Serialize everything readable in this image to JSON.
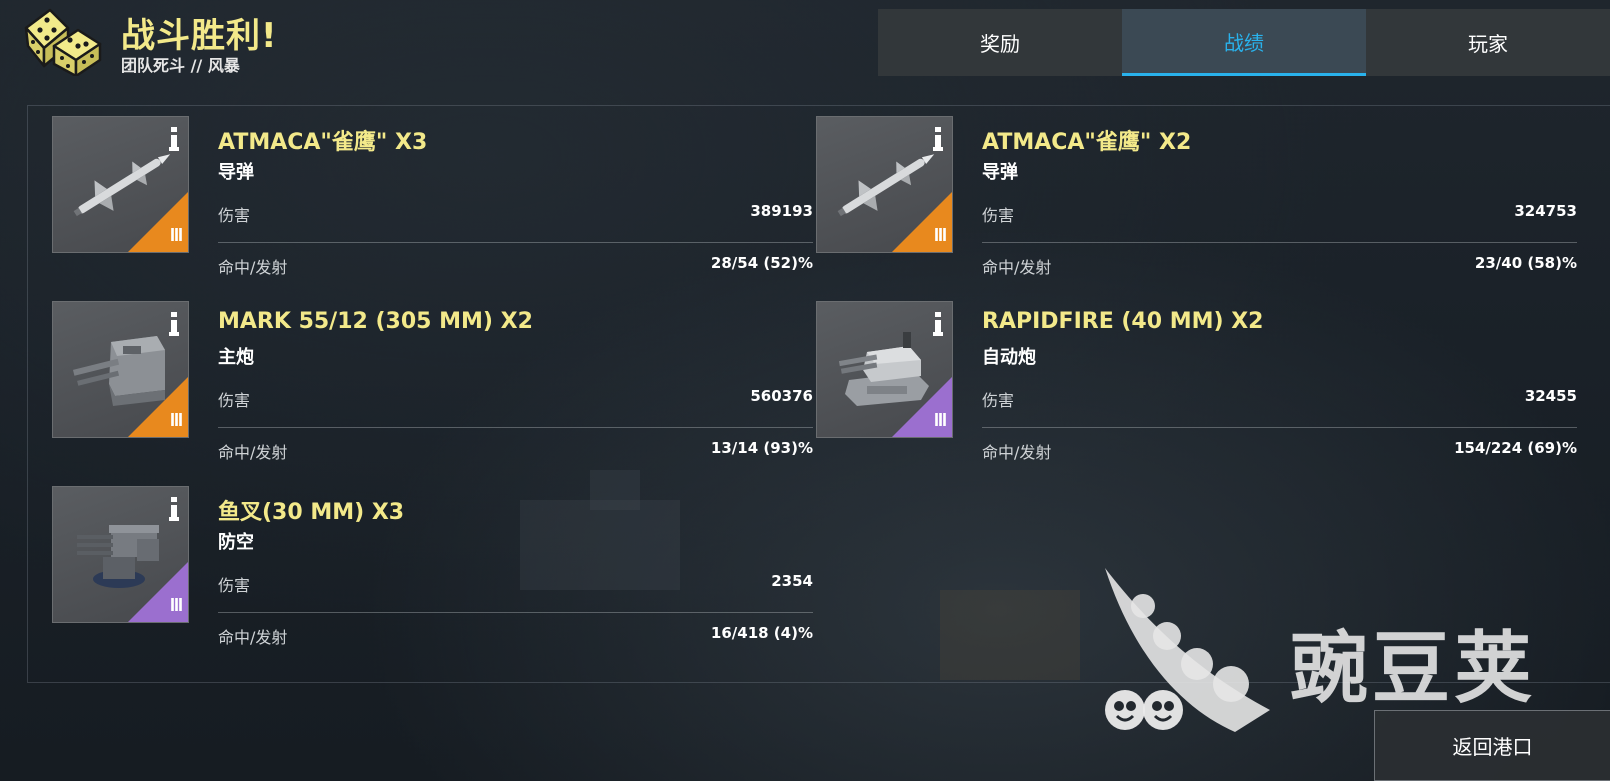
{
  "header": {
    "title": "战斗胜利!",
    "subtitle": "团队死斗 // 风暴"
  },
  "tabs": [
    {
      "label": "奖励",
      "active": false
    },
    {
      "label": "战绩",
      "active": true
    },
    {
      "label": "玩家",
      "active": false
    }
  ],
  "stats_labels": {
    "damage": "伤害",
    "hits": "命中/发射"
  },
  "weapons": [
    {
      "name": "ATMACA\"雀鹰\" X3",
      "type": "导弹",
      "damage": "389193",
      "hits": "28/54 (52)%",
      "tier": "III",
      "tier_color": "#e8891e",
      "icon": "missile-icon"
    },
    {
      "name": "ATMACA\"雀鹰\" X2",
      "type": "导弹",
      "damage": "324753",
      "hits": "23/40 (58)%",
      "tier": "III",
      "tier_color": "#e8891e",
      "icon": "missile-icon"
    },
    {
      "name": "MARK 55/12 (305 MM) X2",
      "type": "主炮",
      "damage": "560376",
      "hits": "13/14 (93)%",
      "tier": "III",
      "tier_color": "#e8891e",
      "icon": "main-gun-turret-icon"
    },
    {
      "name": "RAPIDFIRE (40 MM) X2",
      "type": "自动炮",
      "damage": "32455",
      "hits": "154/224 (69)%",
      "tier": "III",
      "tier_color": "#9b6fcf",
      "icon": "autocannon-turret-icon"
    },
    {
      "name": "鱼叉(30 MM) X3",
      "type": "防空",
      "damage": "2354",
      "hits": "16/418 (4)%",
      "tier": "III",
      "tier_color": "#9b6fcf",
      "icon": "anti-air-gun-icon"
    }
  ],
  "watermark": "豌豆荚",
  "return_button": "返回港口",
  "colors": {
    "accent": "#29b2ec",
    "title_yellow": "#f3e98a",
    "tier_orange": "#e8891e",
    "tier_purple": "#9b6fcf"
  }
}
